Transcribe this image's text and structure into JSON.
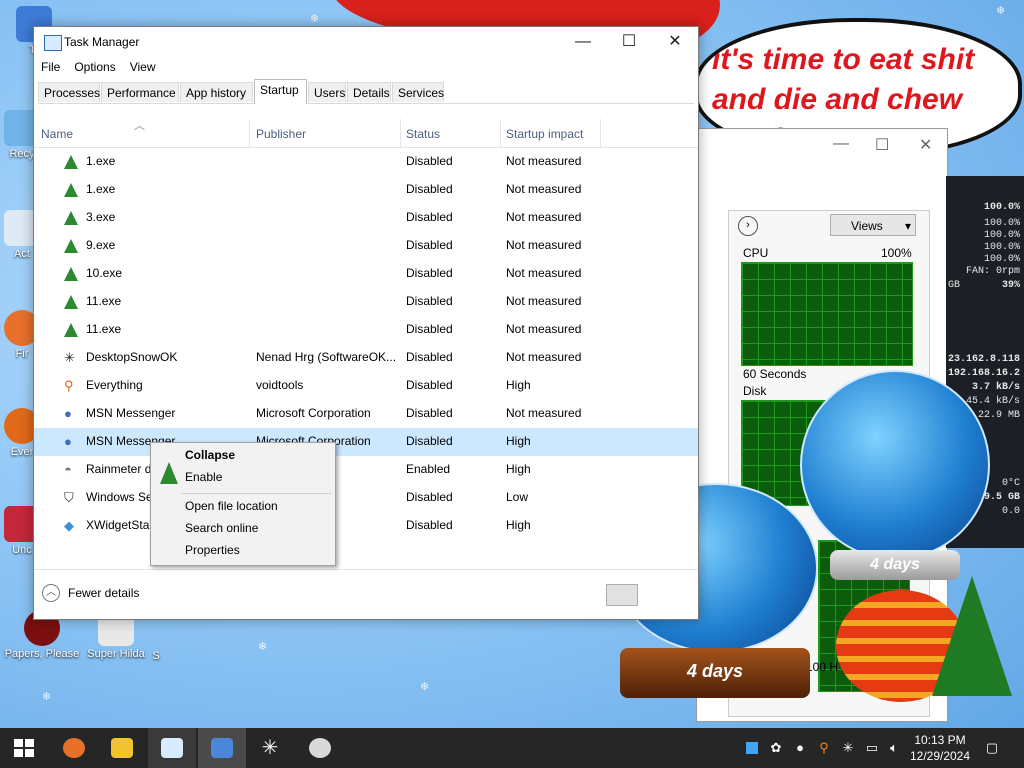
{
  "window": {
    "title": "Task Manager",
    "controls": {
      "minimize": "—",
      "maximize": "☐",
      "close": "✕"
    }
  },
  "menu": [
    "File",
    "Options",
    "View"
  ],
  "tabs": [
    {
      "label": "Processes",
      "active": false
    },
    {
      "label": "Performance",
      "active": false
    },
    {
      "label": "App history",
      "active": false
    },
    {
      "label": "Startup",
      "active": true
    },
    {
      "label": "Users",
      "active": false
    },
    {
      "label": "Details",
      "active": false
    },
    {
      "label": "Services",
      "active": false
    }
  ],
  "columns": {
    "name": "Name",
    "publisher": "Publisher",
    "status": "Status",
    "impact": "Startup impact"
  },
  "rows": [
    {
      "icon": "tree-icon",
      "name": "1.exe",
      "publisher": "",
      "status": "Disabled",
      "impact": "Not measured",
      "selected": false
    },
    {
      "icon": "tree-icon",
      "name": "1.exe",
      "publisher": "",
      "status": "Disabled",
      "impact": "Not measured",
      "selected": false
    },
    {
      "icon": "tree-icon",
      "name": "3.exe",
      "publisher": "",
      "status": "Disabled",
      "impact": "Not measured",
      "selected": false
    },
    {
      "icon": "tree-icon",
      "name": "9.exe",
      "publisher": "",
      "status": "Disabled",
      "impact": "Not measured",
      "selected": false
    },
    {
      "icon": "tree-icon",
      "name": "10.exe",
      "publisher": "",
      "status": "Disabled",
      "impact": "Not measured",
      "selected": false
    },
    {
      "icon": "tree-icon",
      "name": "11.exe",
      "publisher": "",
      "status": "Disabled",
      "impact": "Not measured",
      "selected": false
    },
    {
      "icon": "tree-icon",
      "name": "11.exe",
      "publisher": "",
      "status": "Disabled",
      "impact": "Not measured",
      "selected": false
    },
    {
      "icon": "snowflake-icon",
      "name": "DesktopSnowOK",
      "publisher": "Nenad Hrg (SoftwareOK...",
      "status": "Disabled",
      "impact": "Not measured",
      "selected": false
    },
    {
      "icon": "search-icon",
      "name": "Everything",
      "publisher": "voidtools",
      "status": "Disabled",
      "impact": "High",
      "selected": false
    },
    {
      "icon": "messenger-icon",
      "name": "MSN Messenger",
      "publisher": "Microsoft Corporation",
      "status": "Disabled",
      "impact": "Not measured",
      "selected": false
    },
    {
      "icon": "messenger-icon",
      "name": "MSN Messenger",
      "publisher": "Microsoft Corporation",
      "status": "Disabled",
      "impact": "High",
      "selected": true
    },
    {
      "icon": "raindrop-icon",
      "name": "Rainmeter d",
      "publisher": "",
      "status": "Enabled",
      "impact": "High",
      "selected": false
    },
    {
      "icon": "shield-icon",
      "name": "Windows Se",
      "publisher": "oration",
      "status": "Disabled",
      "impact": "Low",
      "selected": false
    },
    {
      "icon": "widget-icon",
      "name": "XWidgetStar",
      "publisher": "",
      "status": "Disabled",
      "impact": "High",
      "selected": false
    }
  ],
  "context_menu": {
    "collapse": "Collapse",
    "enable": "Enable",
    "open_location": "Open file location",
    "search_online": "Search online",
    "properties": "Properties"
  },
  "footer": {
    "fewer_details": "Fewer details"
  },
  "bubble_text": "it's time to eat shit and die and chew candy canes",
  "perf": {
    "views": "Views",
    "cpu_label": "CPU",
    "cpu_max": "100%",
    "time_label": "60 Seconds",
    "disk_label": "Disk",
    "disk_partial": "100 H"
  },
  "sidebar": [
    "100.0%",
    "100.0%",
    "100.0%",
    "100.0%",
    "100.0%",
    "FAN: 0rpm",
    "GB",
    "39%",
    "23.162.8.118",
    "192.168.16.2",
    "3.7 kB/s",
    "45.4 kB/s",
    "22.9 MB",
    "0°C",
    "9.5 GB",
    "0.0"
  ],
  "globes": {
    "left_days": "4 days",
    "right_days": "4 days"
  },
  "desktop_icons": [
    "Tr",
    "Recy",
    "Act",
    "Fir",
    "Ever",
    "Unc",
    "Papers, Please",
    "Super Hilda",
    "S"
  ],
  "taskbar": {
    "apps": [
      "windows-start",
      "firefox",
      "file-explorer",
      "task-manager-pinned",
      "task-manager",
      "desktop-snow",
      "navigator"
    ],
    "time": "10:13 PM",
    "date": "12/29/2024",
    "tray": [
      "color-icon",
      "feather-icon",
      "drop-icon",
      "search-icon",
      "snowflake-icon",
      "network-icon",
      "volume-icon",
      "notification-icon"
    ]
  },
  "colors": {
    "selection": "#cce8ff",
    "header_text": "#4d6082",
    "taskbar": "#262626",
    "bubble_text": "#e0161d"
  }
}
